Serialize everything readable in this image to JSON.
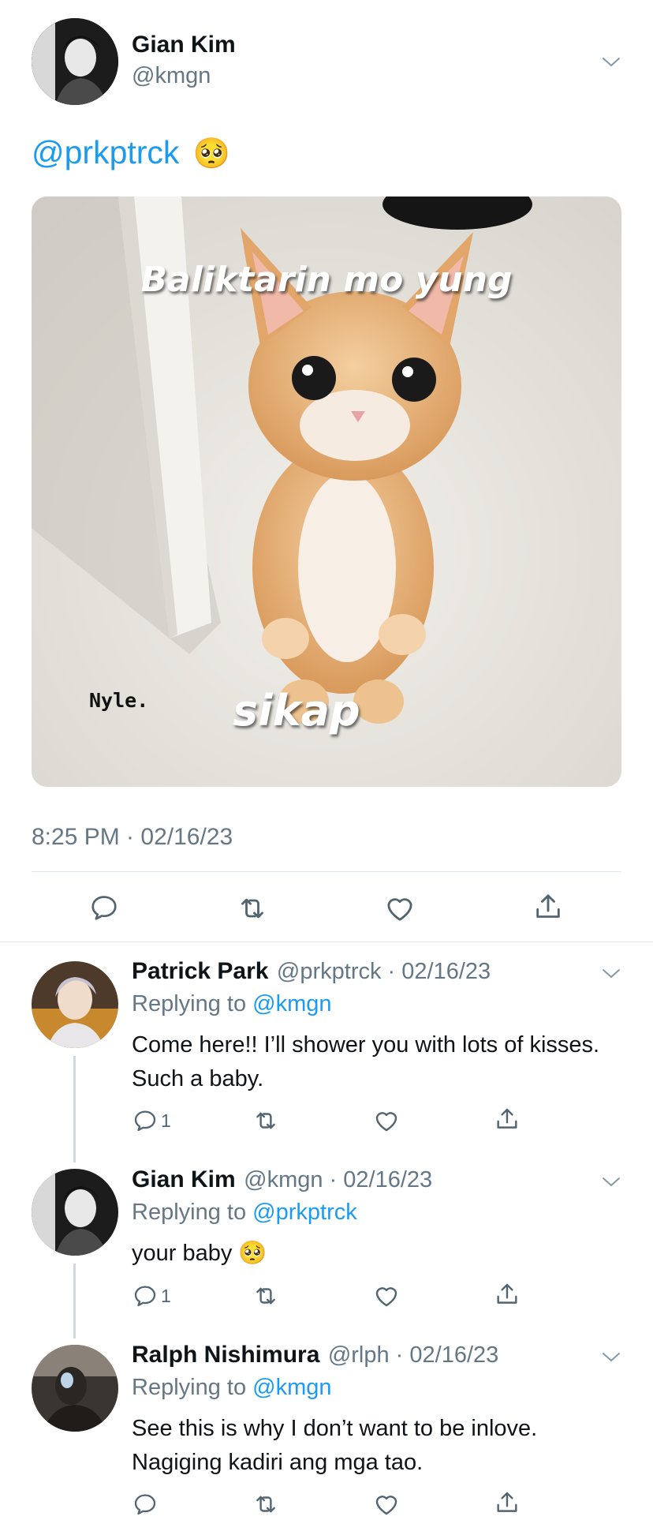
{
  "main_tweet": {
    "display_name": "Gian Kim",
    "handle": "@kmgn",
    "mention": "@prkptrck",
    "emoji": "🥺",
    "meme_top_text": "Baliktarin mo yung",
    "meme_bottom_text": "sikap",
    "meme_watermark": "Nyle.",
    "timestamp": "8:25 PM · 02/16/23"
  },
  "icons": {
    "reply": "reply-icon",
    "retweet": "retweet-icon",
    "like": "heart-icon",
    "share": "share-icon",
    "more": "chevron-down-icon"
  },
  "colors": {
    "link": "#1d9bf0",
    "muted": "#657786",
    "divider": "#e1e8ed",
    "thread_line": "#cfd9de"
  },
  "replies": [
    {
      "display_name": "Patrick Park",
      "handle_date": "@prkptrck · 02/16/23",
      "replying_label": "Replying to",
      "replying_handle": "@kmgn",
      "text": "Come here!! I’ll shower you with lots of kisses. Such a baby.",
      "reply_count": "1"
    },
    {
      "display_name": "Gian Kim",
      "handle_date": "@kmgn · 02/16/23",
      "replying_label": "Replying to",
      "replying_handle": "@prkptrck",
      "text": "your baby 🥺",
      "reply_count": "1"
    },
    {
      "display_name": "Ralph Nishimura",
      "handle_date": "@rlph · 02/16/23",
      "replying_label": "Replying to",
      "replying_handle": "@kmgn",
      "text": "See this is why I don’t want to be inlove. Nagiging kadiri ang mga tao.",
      "reply_count": ""
    }
  ]
}
